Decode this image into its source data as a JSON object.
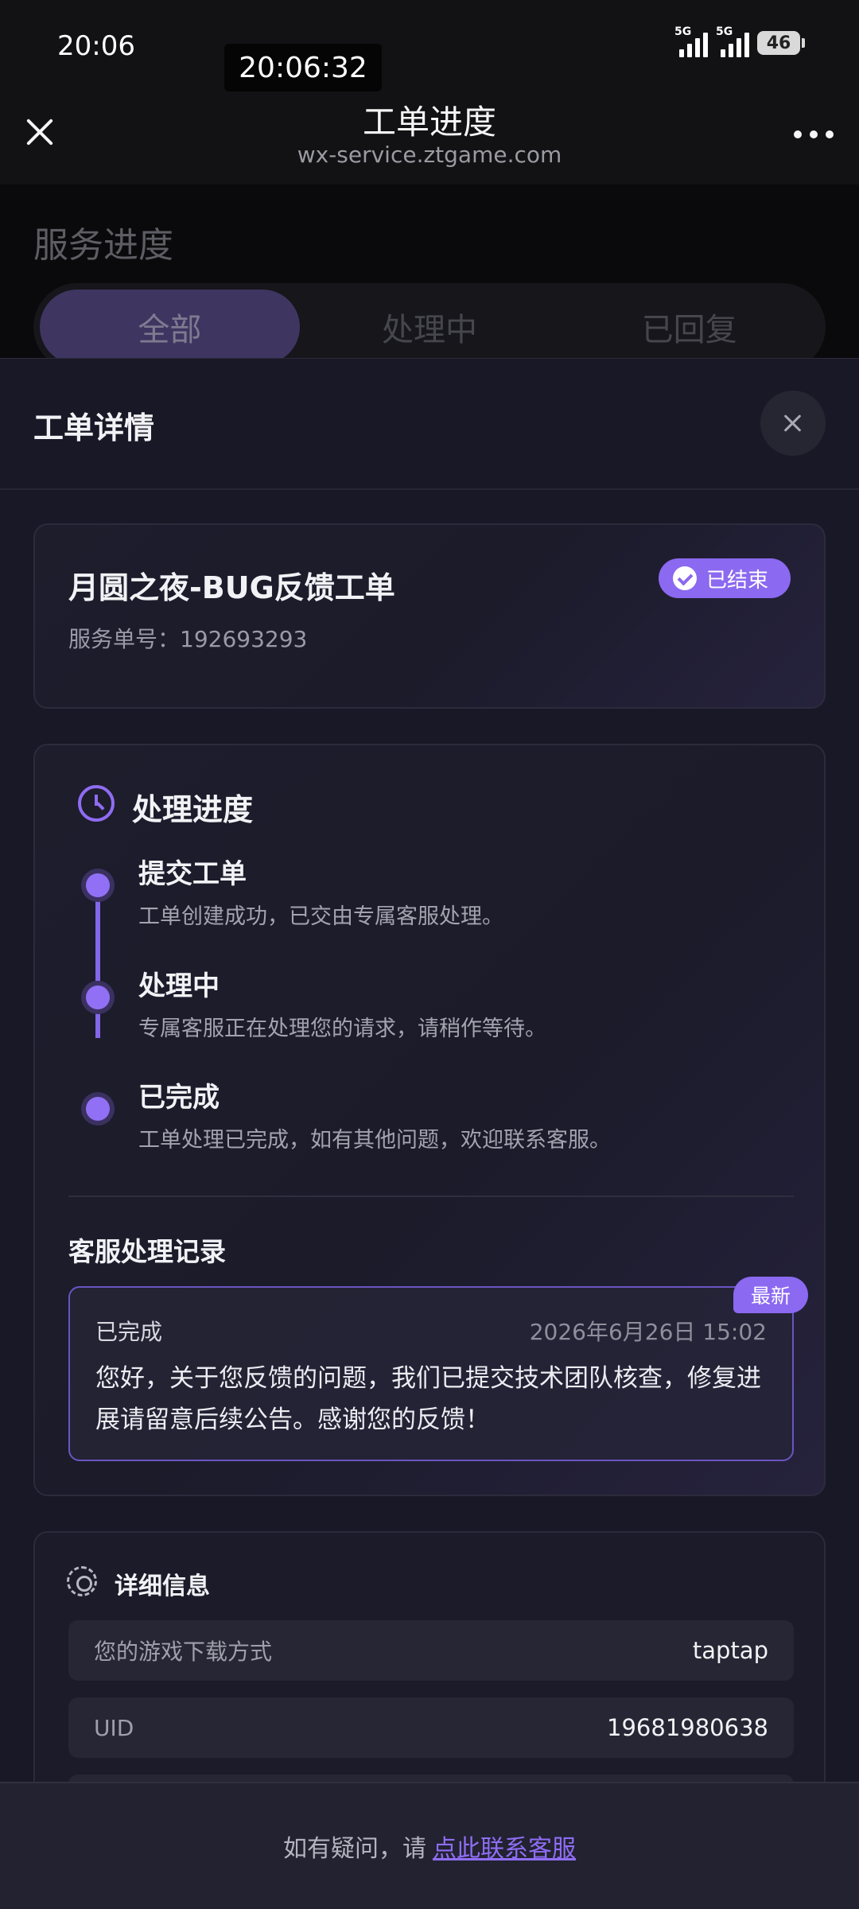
{
  "status_bar": {
    "time": "20:06",
    "overlay_time": "20:06:32",
    "network_1": "5G",
    "network_2": "5G",
    "battery": "46"
  },
  "webview": {
    "title": "工单进度",
    "url": "wx-service.ztgame.com"
  },
  "background_page": {
    "title": "服务进度",
    "tabs": [
      {
        "label": "全部",
        "active": true
      },
      {
        "label": "处理中",
        "active": false
      },
      {
        "label": "已回复",
        "active": false
      }
    ]
  },
  "sheet": {
    "title": "工单详情"
  },
  "ticket": {
    "title": "月圆之夜-BUG反馈工单",
    "number": "服务单号：192693293",
    "status": "已结束"
  },
  "progress": {
    "title": "处理进度",
    "steps": [
      {
        "title": "提交工单",
        "desc": "工单创建成功，已交由专属客服处理。"
      },
      {
        "title": "处理中",
        "desc": "专属客服正在处理您的请求，请稍作等待。"
      },
      {
        "title": "已完成",
        "desc": "工单处理已完成，如有其他问题，欢迎联系客服。"
      }
    ]
  },
  "records": {
    "title": "客服处理记录",
    "items": [
      {
        "badge": "最新",
        "status": "已完成",
        "time": "2026年6月26日 15:02",
        "body": "您好，关于您反馈的问题，我们已提交技术团队核查，修复进展请留意后续公告。感谢您的反馈！"
      }
    ]
  },
  "details": {
    "title": "详细信息",
    "rows": [
      {
        "key": "您的游戏下载方式",
        "value": "taptap"
      },
      {
        "key": "UID",
        "value": "19681980638"
      }
    ]
  },
  "footer": {
    "prefix": "如有疑问，请",
    "link": "点此联系客服"
  },
  "colors": {
    "accent": "#8b69f0",
    "background": "#181826"
  }
}
